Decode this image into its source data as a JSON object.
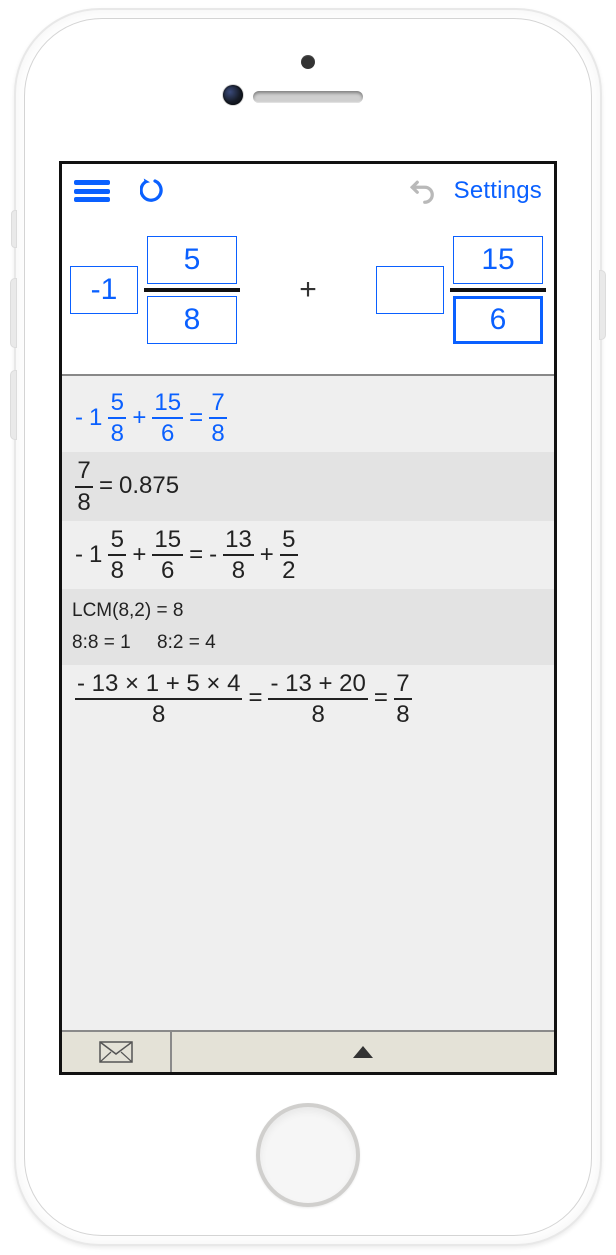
{
  "toolbar": {
    "settings_label": "Settings"
  },
  "input": {
    "left": {
      "whole": "-1",
      "numerator": "5",
      "denominator": "8"
    },
    "operator": "+",
    "right": {
      "whole": "",
      "numerator": "15",
      "denominator": "6"
    }
  },
  "results": {
    "line1": {
      "lead_minus": "-",
      "mixed_whole": "1",
      "mixed_num": "5",
      "mixed_den": "8",
      "plus": "+",
      "frac2_num": "15",
      "frac2_den": "6",
      "eq": "=",
      "ans_num": "7",
      "ans_den": "8"
    },
    "line2": {
      "frac_num": "7",
      "frac_den": "8",
      "eq": "=",
      "decimal": "0.875"
    },
    "line3": {
      "lead_minus": "-",
      "mixed_whole": "1",
      "mixed_num": "5",
      "mixed_den": "8",
      "plus1": "+",
      "frac2_num": "15",
      "frac2_den": "6",
      "eq": "=",
      "minus2": "-",
      "frac3_num": "13",
      "frac3_den": "8",
      "plus2": "+",
      "frac4_num": "5",
      "frac4_den": "2"
    },
    "lcm": {
      "l1": "LCM(8,2) = 8",
      "l2": "8:8 = 1     8:2 = 4"
    },
    "line5": {
      "big1_num": "- 13 × 1 + 5 × 4",
      "big1_den": "8",
      "eq1": "=",
      "big2_num": "- 13 + 20",
      "big2_den": "8",
      "eq2": "=",
      "ans_num": "7",
      "ans_den": "8"
    }
  }
}
